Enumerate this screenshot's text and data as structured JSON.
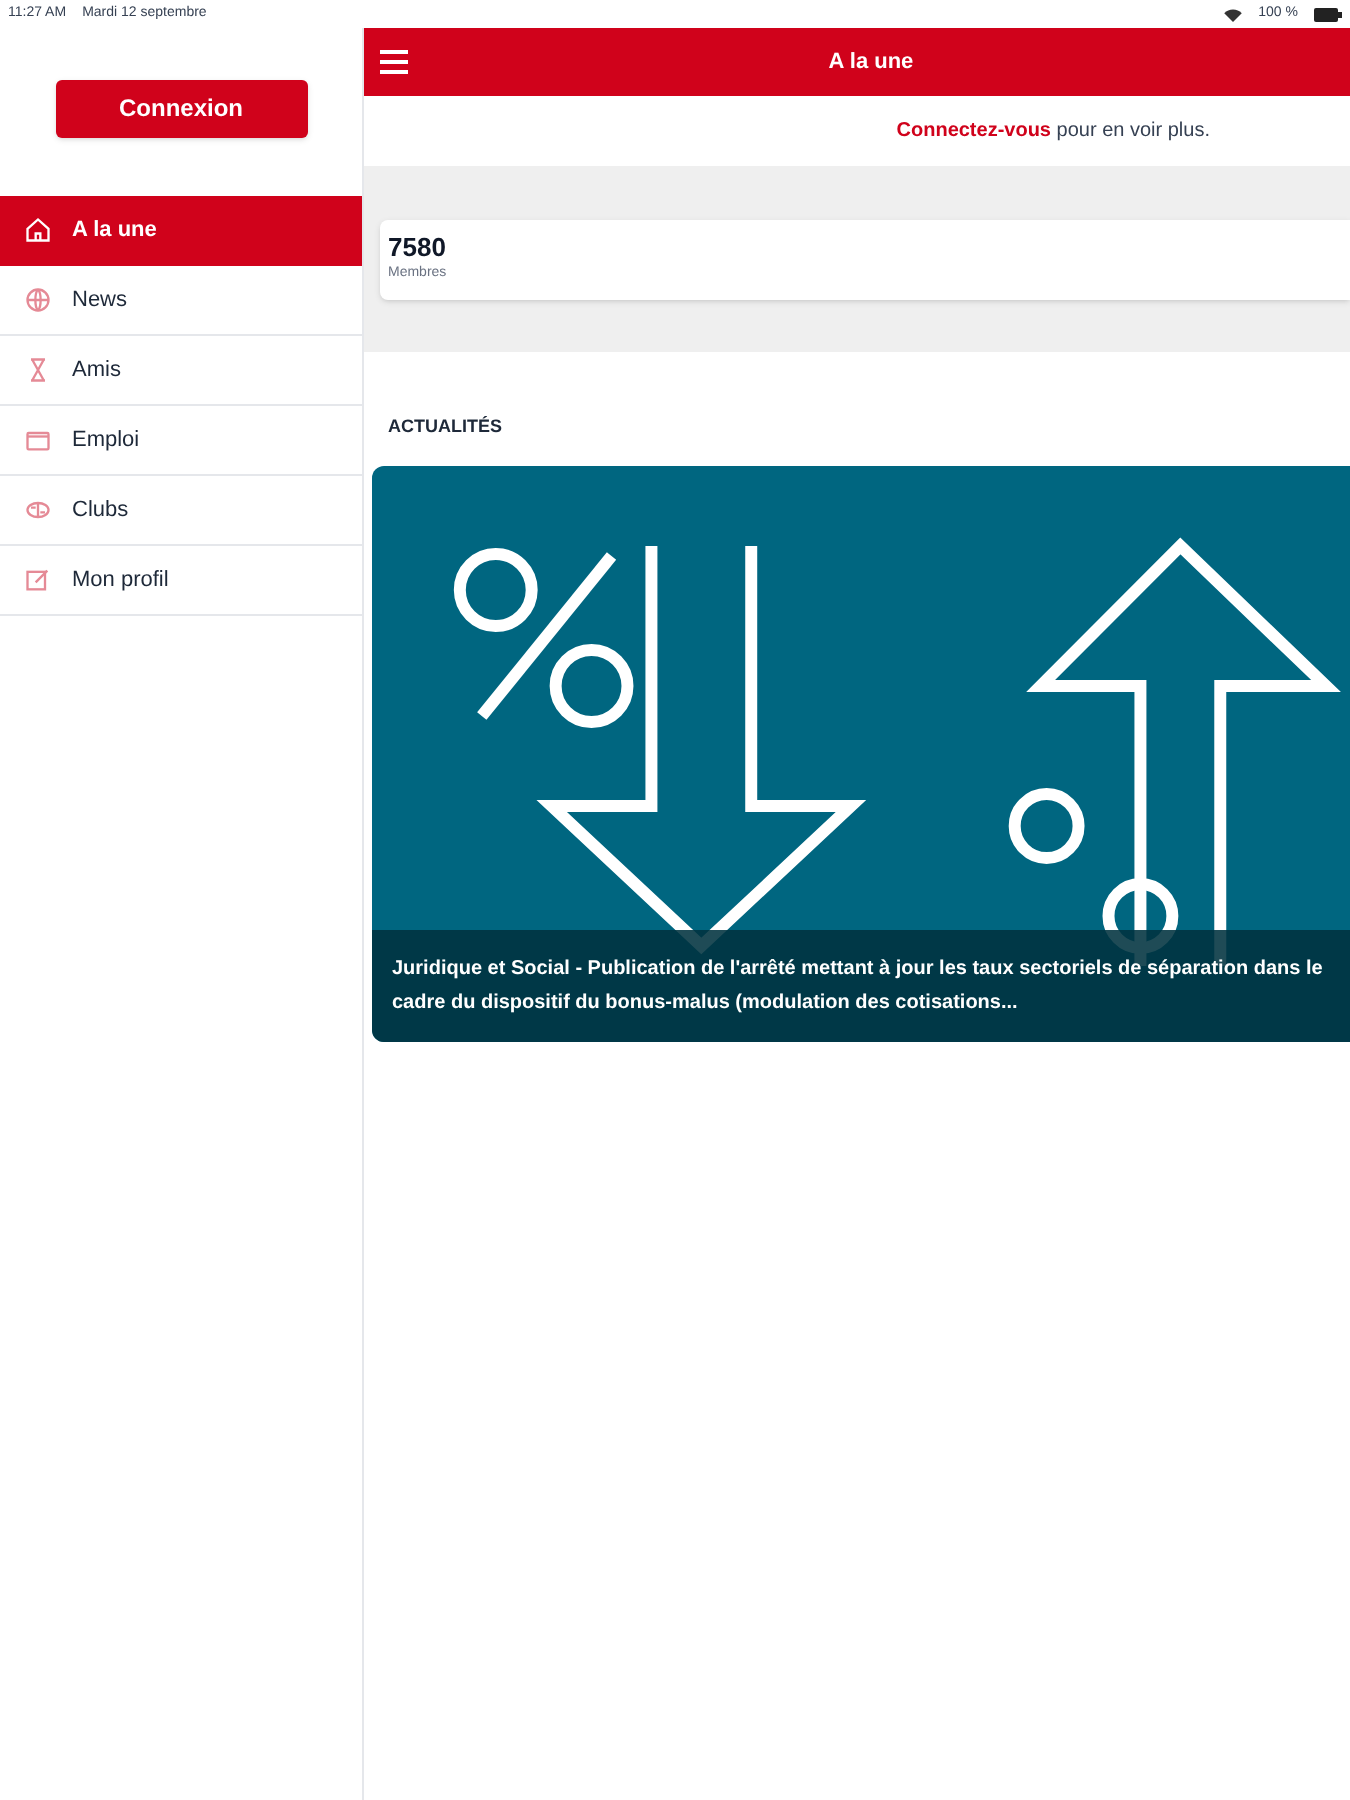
{
  "status_bar": {
    "time": "11:27 AM",
    "date": "Mardi 12 septembre",
    "battery": "100 %"
  },
  "sidebar": {
    "login_button": "Connexion",
    "items": [
      {
        "label": "A la une",
        "kind": "home",
        "selected": true
      },
      {
        "label": "News",
        "kind": "globe",
        "selected": false
      },
      {
        "label": "Amis",
        "kind": "person",
        "selected": false
      },
      {
        "label": "Emploi",
        "kind": "briefcase",
        "selected": false
      },
      {
        "label": "Clubs",
        "kind": "clubs",
        "selected": false
      },
      {
        "label": "Mon profil",
        "kind": "edit",
        "selected": false
      }
    ]
  },
  "header": {
    "title": "A la une"
  },
  "login_prompt": {
    "link": "Connectez-vous",
    "text": "pour en voir plus."
  },
  "stats": {
    "value": "7580",
    "label": "Membres"
  },
  "news": {
    "heading": "ACTUALITÉS",
    "articles": [
      {
        "kind": "picture",
        "caption": "Juridique et Social - Publication de l'arrêté mettant à jour les taux sectoriels de séparation dans le cadre du dispositif du bonus-malus (modulation des cotisations..."
      }
    ]
  }
}
